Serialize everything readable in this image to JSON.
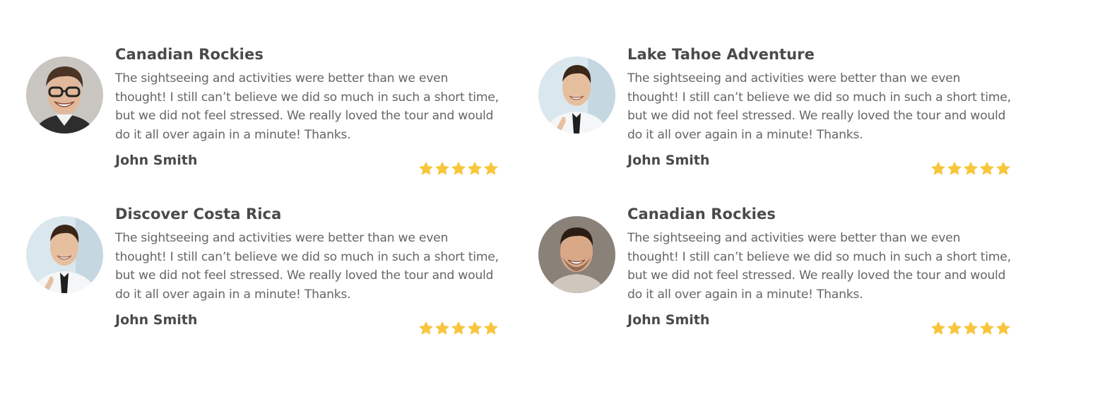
{
  "accent_colors": {
    "star": "#F8C63D",
    "heading": "#4A4A4A",
    "body_text": "#666666"
  },
  "reviews": [
    {
      "title": "Canadian Rockies",
      "text": "The sightseeing and activities were better than we even thought! I still can’t believe we did so much in such a short time, but we did not feel stressed. We really loved the tour and would do it all over again in a minute! Thanks.",
      "author": "John Smith",
      "rating": 5,
      "avatar_icon": "avatar-man-glasses-icon"
    },
    {
      "title": "Lake Tahoe Adventure",
      "text": "The sightseeing and activities were better than we even thought! I still can’t believe we did so much in such a short time, but we did not feel stressed. We really loved the tour and would do it all over again in a minute! Thanks.",
      "author": "John Smith",
      "rating": 5,
      "avatar_icon": "avatar-man-tie-icon"
    },
    {
      "title": "Discover Costa Rica",
      "text": "The sightseeing and activities were better than we even thought! I still can’t believe we did so much in such a short time, but we did not feel stressed. We really loved the tour and would do it all over again in a minute! Thanks.",
      "author": "John Smith",
      "rating": 5,
      "avatar_icon": "avatar-man-tie-icon"
    },
    {
      "title": "Canadian Rockies",
      "text": "The sightseeing and activities were better than we even thought! I still can’t believe we did so much in such a short time, but we did not feel stressed. We really loved the tour and would do it all over again in a minute! Thanks.",
      "author": "John Smith",
      "rating": 5,
      "avatar_icon": "avatar-man-smiling-icon"
    }
  ]
}
